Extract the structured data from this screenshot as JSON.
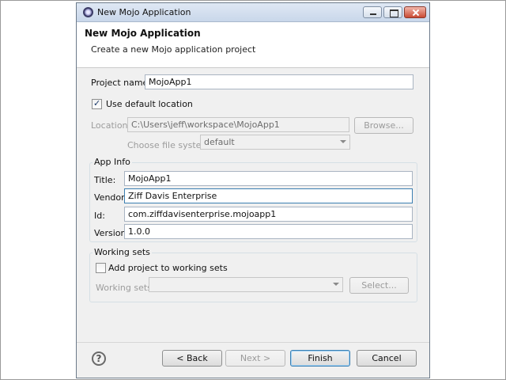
{
  "window": {
    "title": "New Mojo Application"
  },
  "header": {
    "title": "New Mojo Application",
    "description": "Create a new Mojo application project"
  },
  "project": {
    "name_label": "Project name:",
    "name_value": "MojoApp1",
    "use_default_location_label": "Use default location",
    "use_default_location_checked": true,
    "location_label": "Location:",
    "location_value": "C:\\Users\\jeff\\workspace\\MojoApp1",
    "browse_label": "Browse...",
    "filesystem_label": "Choose file system:",
    "filesystem_value": "default"
  },
  "app_info": {
    "legend": "App Info",
    "title_label": "Title:",
    "title_value": "MojoApp1",
    "vendor_label": "Vendor:",
    "vendor_value": "Ziff Davis Enterprise",
    "id_label": "Id:",
    "id_value": "com.ziffdavisenterprise.mojoapp1",
    "version_label": "Version:",
    "version_value": "1.0.0"
  },
  "working_sets": {
    "legend": "Working sets",
    "add_label": "Add project to working sets",
    "add_checked": false,
    "sets_label": "Working sets:",
    "sets_value": "",
    "select_label": "Select..."
  },
  "footer": {
    "help_glyph": "?",
    "back_label": "< Back",
    "next_label": "Next >",
    "finish_label": "Finish",
    "cancel_label": "Cancel"
  },
  "icons": {
    "app": "mojo-app-icon",
    "help": "help-icon"
  }
}
